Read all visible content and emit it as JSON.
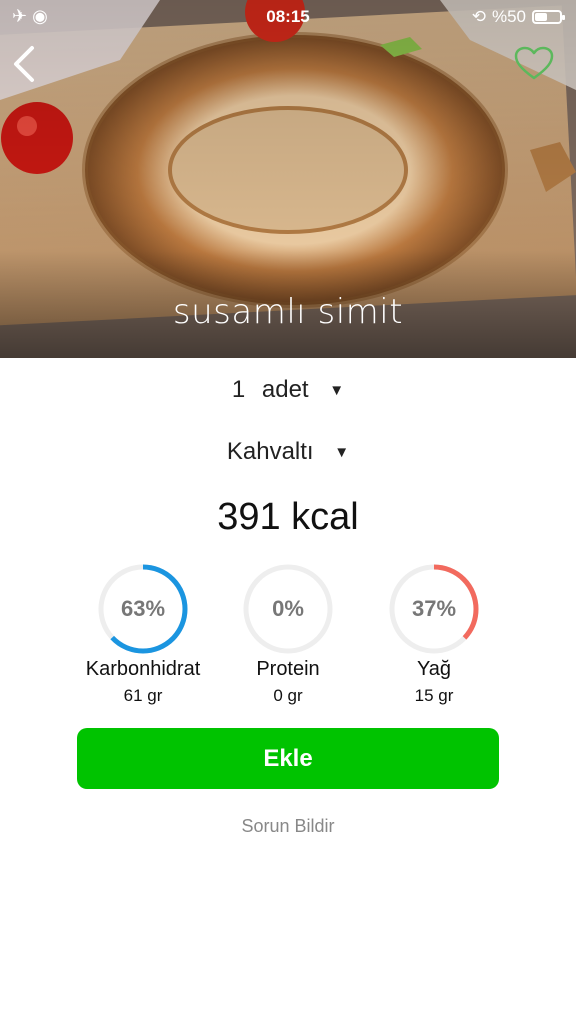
{
  "status_bar": {
    "time": "08:15",
    "battery_text": "%50",
    "battery_level": 0.5
  },
  "food": {
    "name": "susamlı simit"
  },
  "portion": {
    "quantity": "1",
    "unit": "adet"
  },
  "meal": {
    "selected": "Kahvaltı"
  },
  "energy": {
    "label": "391 kcal"
  },
  "macros": [
    {
      "name": "Karbonhidrat",
      "percent": 63,
      "percent_label": "63%",
      "grams": "61 gr",
      "color": "#1b95e0"
    },
    {
      "name": "Protein",
      "percent": 0,
      "percent_label": "0%",
      "grams": "0 gr",
      "color": "#cccccc"
    },
    {
      "name": "Yağ",
      "percent": 37,
      "percent_label": "37%",
      "grams": "15 gr",
      "color": "#f26a5e"
    }
  ],
  "actions": {
    "add_label": "Ekle",
    "report_label": "Sorun Bildir"
  },
  "icons": {
    "back": "chevron-left-icon",
    "favorite": "heart-outline-icon",
    "dropdown": "triangle-down-icon"
  },
  "colors": {
    "accent_green": "#00c300",
    "favorite_green": "#5cb85c"
  }
}
